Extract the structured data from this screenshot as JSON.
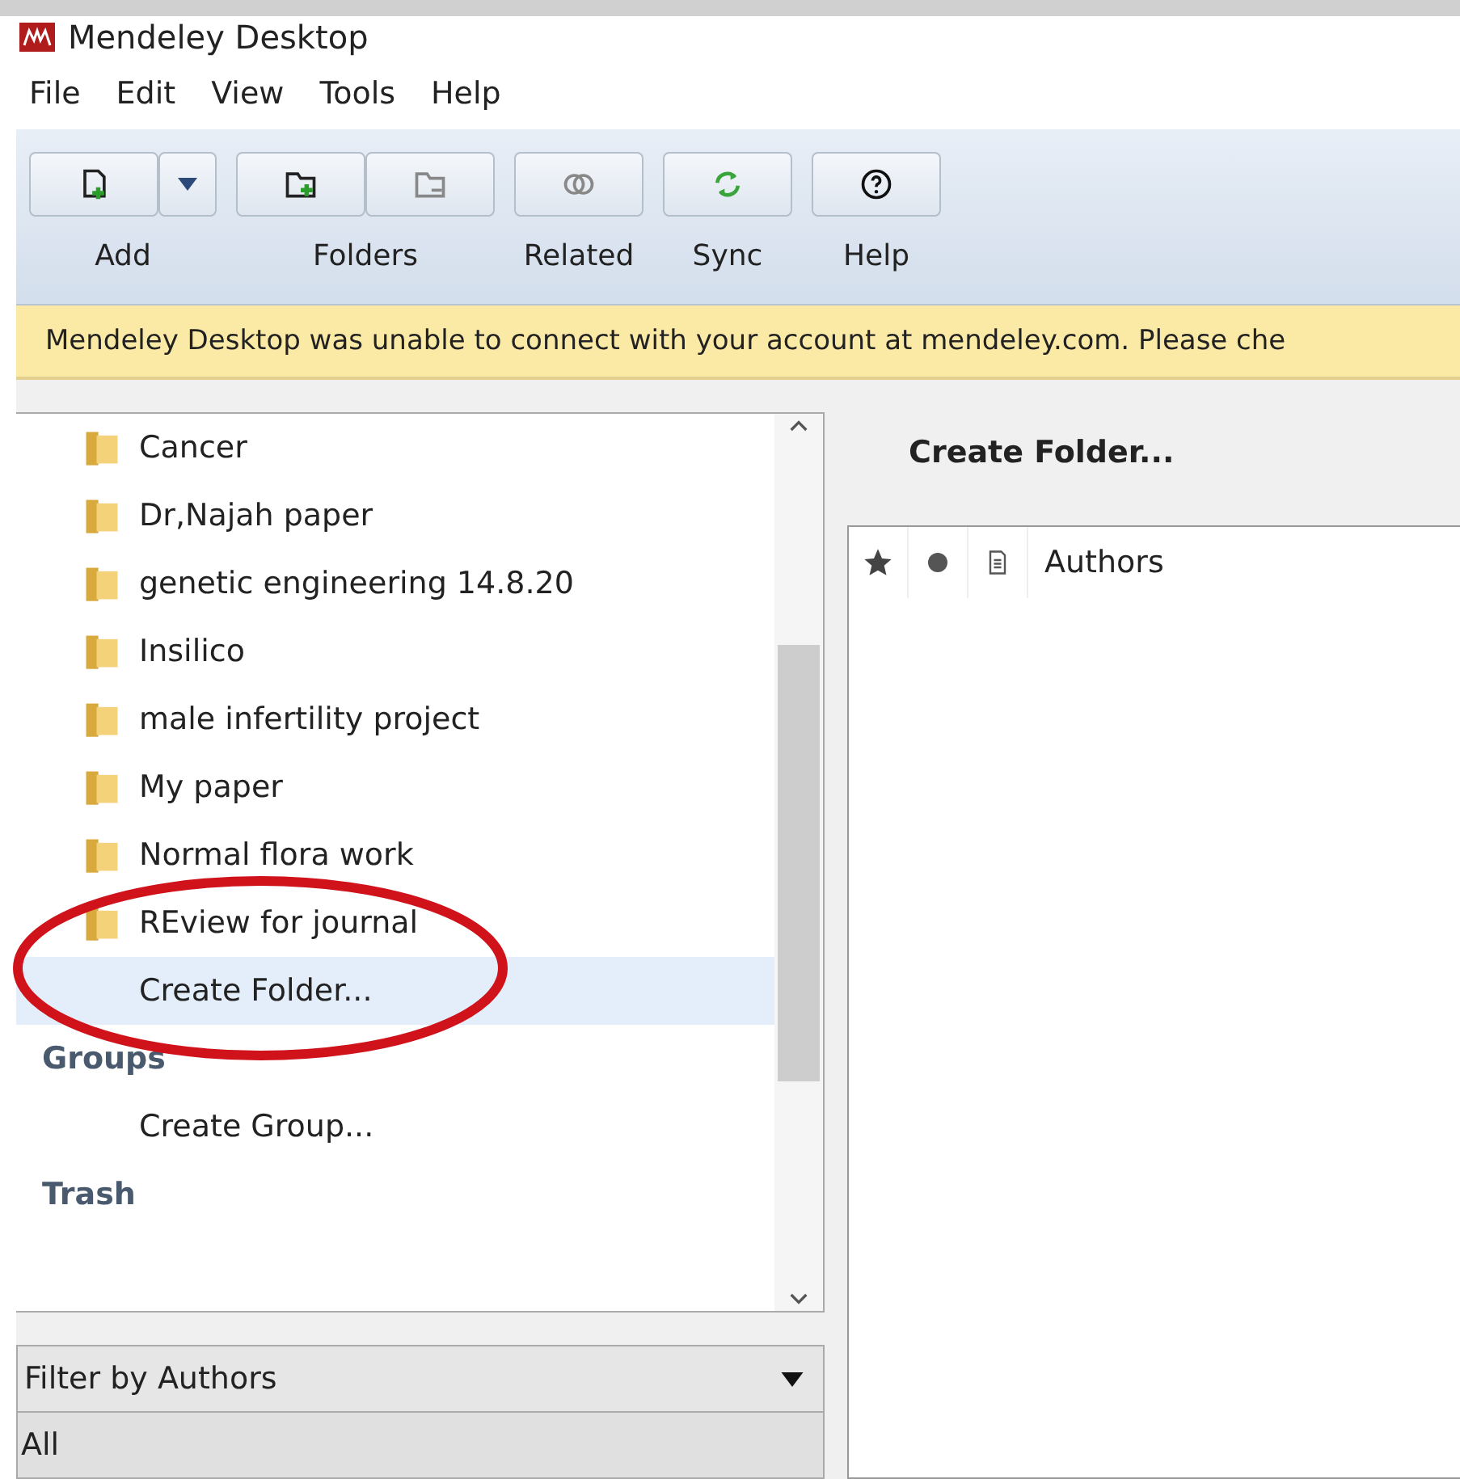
{
  "window": {
    "title": "Mendeley Desktop"
  },
  "menu": [
    "File",
    "Edit",
    "View",
    "Tools",
    "Help"
  ],
  "toolbar": [
    {
      "label": "Add",
      "buttons": [
        {
          "kind": "add"
        },
        {
          "kind": "dropdown"
        }
      ]
    },
    {
      "label": "Folders",
      "buttons": [
        {
          "kind": "folder-add"
        },
        {
          "kind": "folder-remove"
        }
      ]
    },
    {
      "label": "Related",
      "buttons": [
        {
          "kind": "related"
        }
      ]
    },
    {
      "label": "Sync",
      "buttons": [
        {
          "kind": "sync"
        }
      ]
    },
    {
      "label": "Help",
      "buttons": [
        {
          "kind": "help"
        }
      ]
    }
  ],
  "banner": "Mendeley Desktop was unable to connect with your account at mendeley.com. Please che",
  "sidebar": {
    "items": [
      {
        "kind": "folder",
        "label": "Cancer",
        "selected": false
      },
      {
        "kind": "folder",
        "label": "Dr,Najah paper",
        "selected": false
      },
      {
        "kind": "folder",
        "label": "genetic engineering 14.8.20",
        "selected": false
      },
      {
        "kind": "folder",
        "label": "Insilico",
        "selected": false
      },
      {
        "kind": "folder",
        "label": "male infertility project",
        "selected": false
      },
      {
        "kind": "folder",
        "label": "My paper",
        "selected": false
      },
      {
        "kind": "folder",
        "label": "Normal flora work",
        "selected": false
      },
      {
        "kind": "folder",
        "label": "REview for journal",
        "selected": false
      },
      {
        "kind": "action",
        "label": "Create Folder...",
        "selected": true
      },
      {
        "kind": "heading",
        "label": "Groups",
        "selected": false
      },
      {
        "kind": "action",
        "label": "Create Group...",
        "selected": false
      },
      {
        "kind": "heading",
        "label": "Trash",
        "selected": false
      }
    ]
  },
  "filter": {
    "label": "Filter by Authors",
    "value": "All"
  },
  "main": {
    "title": "Create Folder...",
    "columns": [
      {
        "kind": "star"
      },
      {
        "kind": "read"
      },
      {
        "kind": "document"
      },
      {
        "kind": "text",
        "label": "Authors"
      }
    ]
  }
}
